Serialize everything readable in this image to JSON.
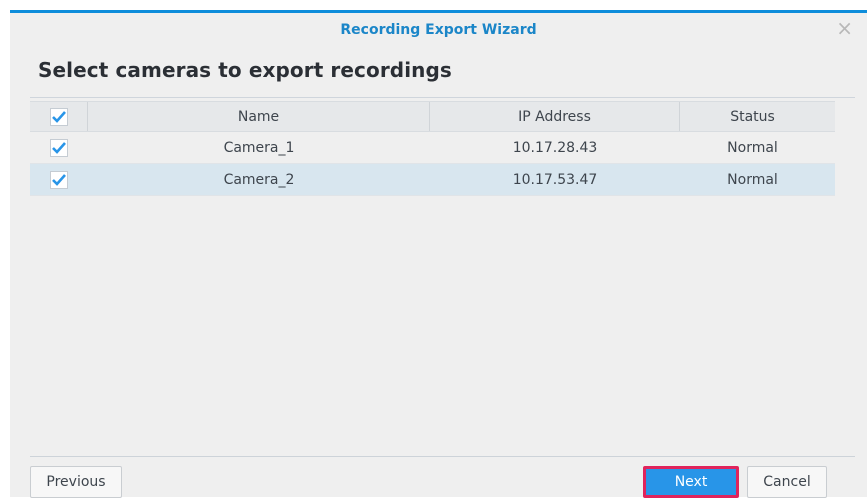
{
  "dialog": {
    "title": "Recording Export Wizard",
    "close_symbol": "×",
    "heading": "Select cameras to export recordings"
  },
  "table": {
    "columns": [
      "Name",
      "IP Address",
      "Status"
    ],
    "header_checked": true,
    "rows": [
      {
        "name": "Camera_1",
        "ip": "10.17.28.43",
        "status": "Normal",
        "checked": true,
        "selected": false
      },
      {
        "name": "Camera_2",
        "ip": "10.17.53.47",
        "status": "Normal",
        "checked": true,
        "selected": true
      }
    ]
  },
  "buttons": {
    "previous": "Previous",
    "next": "Next",
    "cancel": "Cancel"
  },
  "colors": {
    "accent": "#1b86c8",
    "check": "#2895e8",
    "highlight_border": "#e0245c"
  }
}
